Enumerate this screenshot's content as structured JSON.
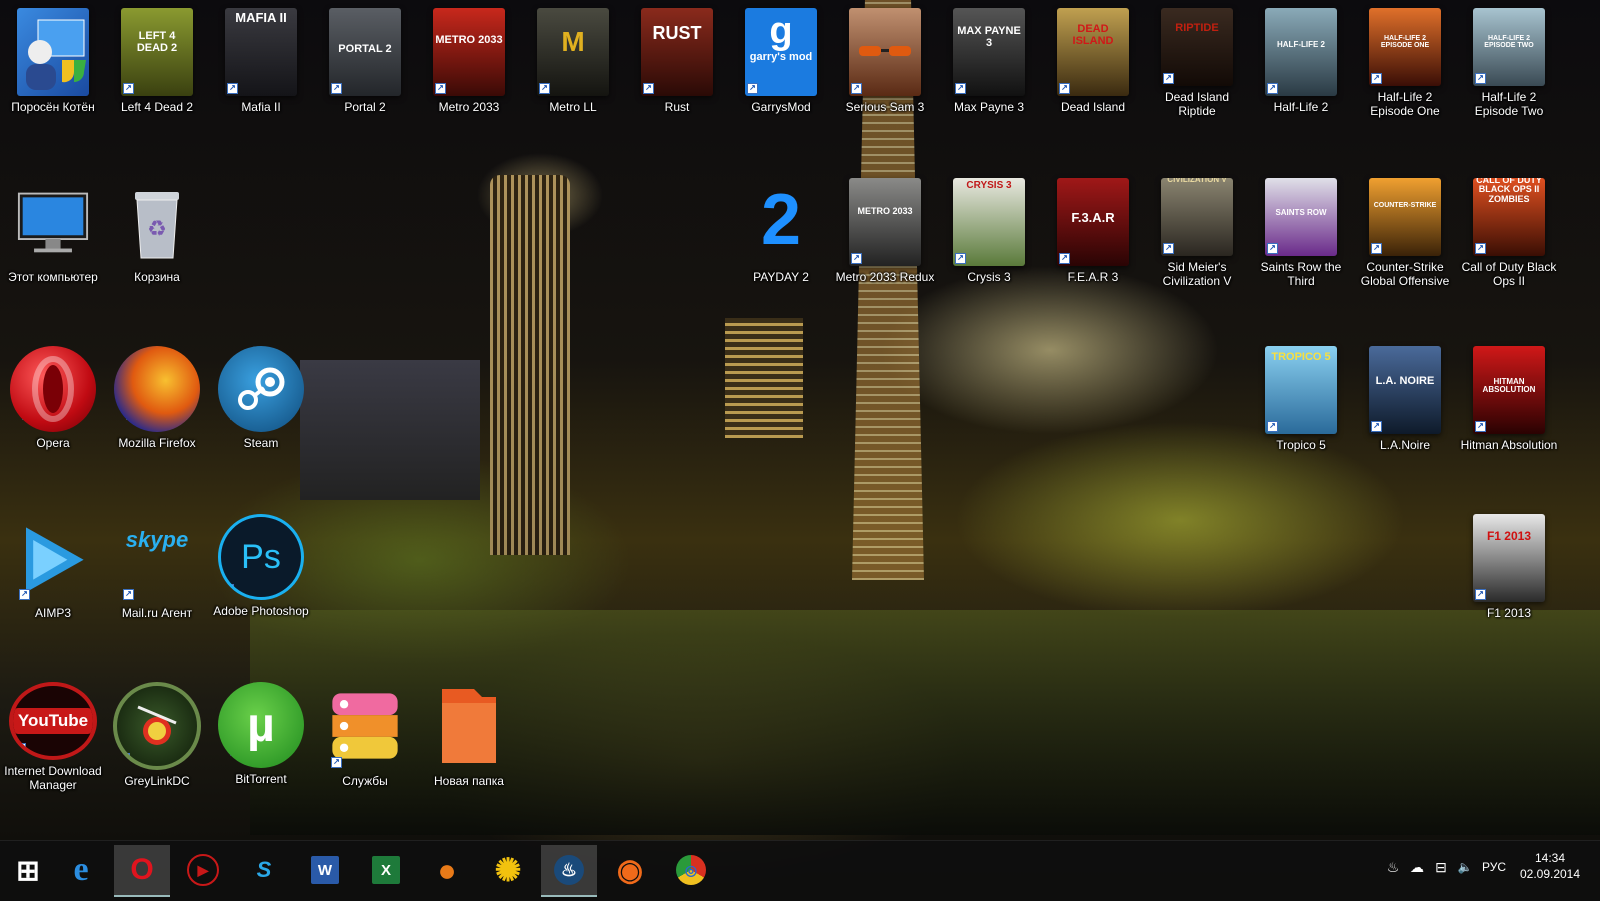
{
  "desktop": {
    "icons": [
      {
        "label": "Поросён Котён",
        "icon": "user-accounts-icon",
        "color": "#2a6fd0"
      },
      {
        "label": "Left 4 Dead 2",
        "icon": "left4dead2-cover-icon",
        "color": "#7a8a22"
      },
      {
        "label": "Mafia II",
        "icon": "mafia2-cover-icon",
        "color": "#2b2b30"
      },
      {
        "label": "Portal 2",
        "icon": "portal2-cover-icon",
        "color": "#3c4046"
      },
      {
        "label": "Metro 2033",
        "icon": "metro2033-cover-icon",
        "color": "#8a1c14"
      },
      {
        "label": "Metro LL",
        "icon": "metro-ll-cover-icon",
        "color": "#2a2a24"
      },
      {
        "label": "Rust",
        "icon": "rust-cover-icon",
        "color": "#6a1e14"
      },
      {
        "label": "GarrysMod",
        "icon": "garrysmod-icon",
        "color": "#1b7be0"
      },
      {
        "label": "Serious Sam 3",
        "icon": "serious-sam3-cover-icon",
        "color": "#7a4a22"
      },
      {
        "label": "Max Payne 3",
        "icon": "max-payne3-cover-icon",
        "color": "#26262a"
      },
      {
        "label": "Dead Island",
        "icon": "dead-island-cover-icon",
        "color": "#7a6a2a"
      },
      {
        "label": "Dead Island Riptide",
        "icon": "dead-island-riptide-cover-icon",
        "color": "#3a2a22"
      },
      {
        "label": "Half-Life 2",
        "icon": "half-life2-cover-icon",
        "color": "#4a6a7a"
      },
      {
        "label": "Half-Life 2 Episode One",
        "icon": "half-life2-ep1-cover-icon",
        "color": "#a03010"
      },
      {
        "label": "Half-Life 2 Episode Two",
        "icon": "half-life2-ep2-cover-icon",
        "color": "#5a7a8a"
      },
      {
        "label": "Этот компьютер",
        "icon": "this-pc-icon",
        "color": "#2a7ad0"
      },
      {
        "label": "Корзина",
        "icon": "recycle-bin-icon",
        "color": "#9aa0aa"
      },
      {
        "label": "PAYDAY 2",
        "icon": "payday2-icon",
        "color": "#1e90ff"
      },
      {
        "label": "Metro 2033 Redux",
        "icon": "metro2033-redux-cover-icon",
        "color": "#3a3a3a"
      },
      {
        "label": "Crysis 3",
        "icon": "crysis3-cover-icon",
        "color": "#3e5a2a"
      },
      {
        "label": "F.E.A.R 3",
        "icon": "fear3-cover-icon",
        "color": "#8a1010"
      },
      {
        "label": "Sid Meier's Civilization V",
        "icon": "civilization5-cover-icon",
        "color": "#4a4436"
      },
      {
        "label": "Saints Row the Third",
        "icon": "saints-row3-cover-icon",
        "color": "#5a2a6a"
      },
      {
        "label": "Counter-Strike Global Offensive",
        "icon": "csgo-cover-icon",
        "color": "#d08a20"
      },
      {
        "label": "Call of Duty Black Ops II",
        "icon": "cod-bo2-cover-icon",
        "color": "#a0301a"
      },
      {
        "label": "Tropico 5",
        "icon": "tropico5-cover-icon",
        "color": "#2a8ad0"
      },
      {
        "label": "L.A.Noire",
        "icon": "la-noire-cover-icon",
        "color": "#1e3a6a"
      },
      {
        "label": "Hitman Absolution",
        "icon": "hitman-absolution-cover-icon",
        "color": "#8a1010"
      },
      {
        "label": "F1 2013",
        "icon": "f1-2013-cover-icon",
        "color": "#2a2a2a"
      },
      {
        "label": "Opera",
        "icon": "opera-icon",
        "color": "#cc0f16"
      },
      {
        "label": "Mozilla Firefox",
        "icon": "firefox-icon",
        "color": "#e66000"
      },
      {
        "label": "Steam",
        "icon": "steam-icon",
        "color": "#1a6aa0"
      },
      {
        "label": "AIMP3",
        "icon": "aimp3-icon",
        "color": "#2a90d0"
      },
      {
        "label": "Mail.ru Агент",
        "icon": "skype-icon",
        "color": "#00a8e8"
      },
      {
        "label": "Adobe Photoshop",
        "icon": "photoshop-icon",
        "color": "#0a1a2a"
      },
      {
        "label": "Internet Download Manager",
        "icon": "youtube-icon",
        "color": "#b01818"
      },
      {
        "label": "GreyLinkDC",
        "icon": "fruit-ninja-icon",
        "color": "#4a6a2a"
      },
      {
        "label": "BitTorrent",
        "icon": "utorrent-icon",
        "color": "#3aaa3a"
      },
      {
        "label": "Службы",
        "icon": "services-icon",
        "color": "#f08020"
      },
      {
        "label": "Новая папка",
        "icon": "folder-icon",
        "color": "#e05a20"
      }
    ],
    "glyphs": {
      "left4dead2": "LEFT 4 DEAD 2",
      "mafia2": "MAFIA II",
      "portal2": "PORTAL 2",
      "metro2033": "METRO 2033",
      "metroll": "M",
      "rust": "RUST",
      "garrysmod": "garry's mod",
      "maxpayne3": "MAX PAYNE 3",
      "deadisland": "DEAD ISLAND",
      "riptide": "RIPTIDE",
      "hl2": "HALF-LIFE 2",
      "hl2ep1": "HALF-LIFE 2 EPISODE ONE",
      "hl2ep2": "HALF-LIFE 2 EPISODE TWO",
      "payday2": "2",
      "metroredux": "METRO 2033",
      "crysis3": "CRYSIS 3",
      "fear3": "F.3.A.R",
      "civ5": "CIVILIZATION V",
      "saintsrow": "SAINTS ROW",
      "csgo": "COUNTER-STRIKE",
      "codbo2": "CALL OF DUTY BLACK OPS II ZOMBIES",
      "tropico5": "TROPICO 5",
      "lanoire": "L.A. NOIRE",
      "hitman": "HITMAN ABSOLUTION",
      "f12013": "F1 2013",
      "youtube": "YouTube",
      "photoshop": "Ps",
      "skype": "skype"
    }
  },
  "taskbar": {
    "buttons": [
      {
        "name": "start-button",
        "icon": "windows-logo-icon",
        "glyph": "⊞",
        "color": "#ffffff"
      },
      {
        "name": "ie-taskbar-button",
        "icon": "internet-explorer-icon",
        "glyph": "e",
        "color": "#2b8de0"
      },
      {
        "name": "opera-taskbar-button",
        "icon": "opera-icon",
        "glyph": "O",
        "color": "#e0141e"
      },
      {
        "name": "youtube-taskbar-button",
        "icon": "youtube-icon",
        "glyph": "▶",
        "color": "#c81818"
      },
      {
        "name": "skype-taskbar-button",
        "icon": "skype-icon",
        "glyph": "S",
        "color": "#2aa8e8"
      },
      {
        "name": "word-taskbar-button",
        "icon": "word-icon",
        "glyph": "W",
        "color": "#2a5aa8"
      },
      {
        "name": "excel-taskbar-button",
        "icon": "excel-icon",
        "glyph": "X",
        "color": "#1e7a3a"
      },
      {
        "name": "game-taskbar-button",
        "icon": "orange-circle-icon",
        "glyph": "●",
        "color": "#e87a18"
      },
      {
        "name": "flower-taskbar-button",
        "icon": "flower-icon",
        "glyph": "✺",
        "color": "#f2c20e"
      },
      {
        "name": "steam-taskbar-button",
        "icon": "steam-icon",
        "glyph": "♨",
        "color": "#ffffff"
      },
      {
        "name": "origin-taskbar-button",
        "icon": "origin-icon",
        "glyph": "◉",
        "color": "#f06a1a"
      },
      {
        "name": "chrome-taskbar-button",
        "icon": "chrome-icon",
        "glyph": "◎",
        "color": "#e8b020"
      }
    ],
    "tray": {
      "steam_glyph": "♨",
      "cloud_glyph": "☁",
      "network_glyph": "⊟",
      "volume_glyph": "🔈",
      "language": "РУС"
    },
    "clock": {
      "time": "14:34",
      "date": "02.09.2014"
    }
  }
}
